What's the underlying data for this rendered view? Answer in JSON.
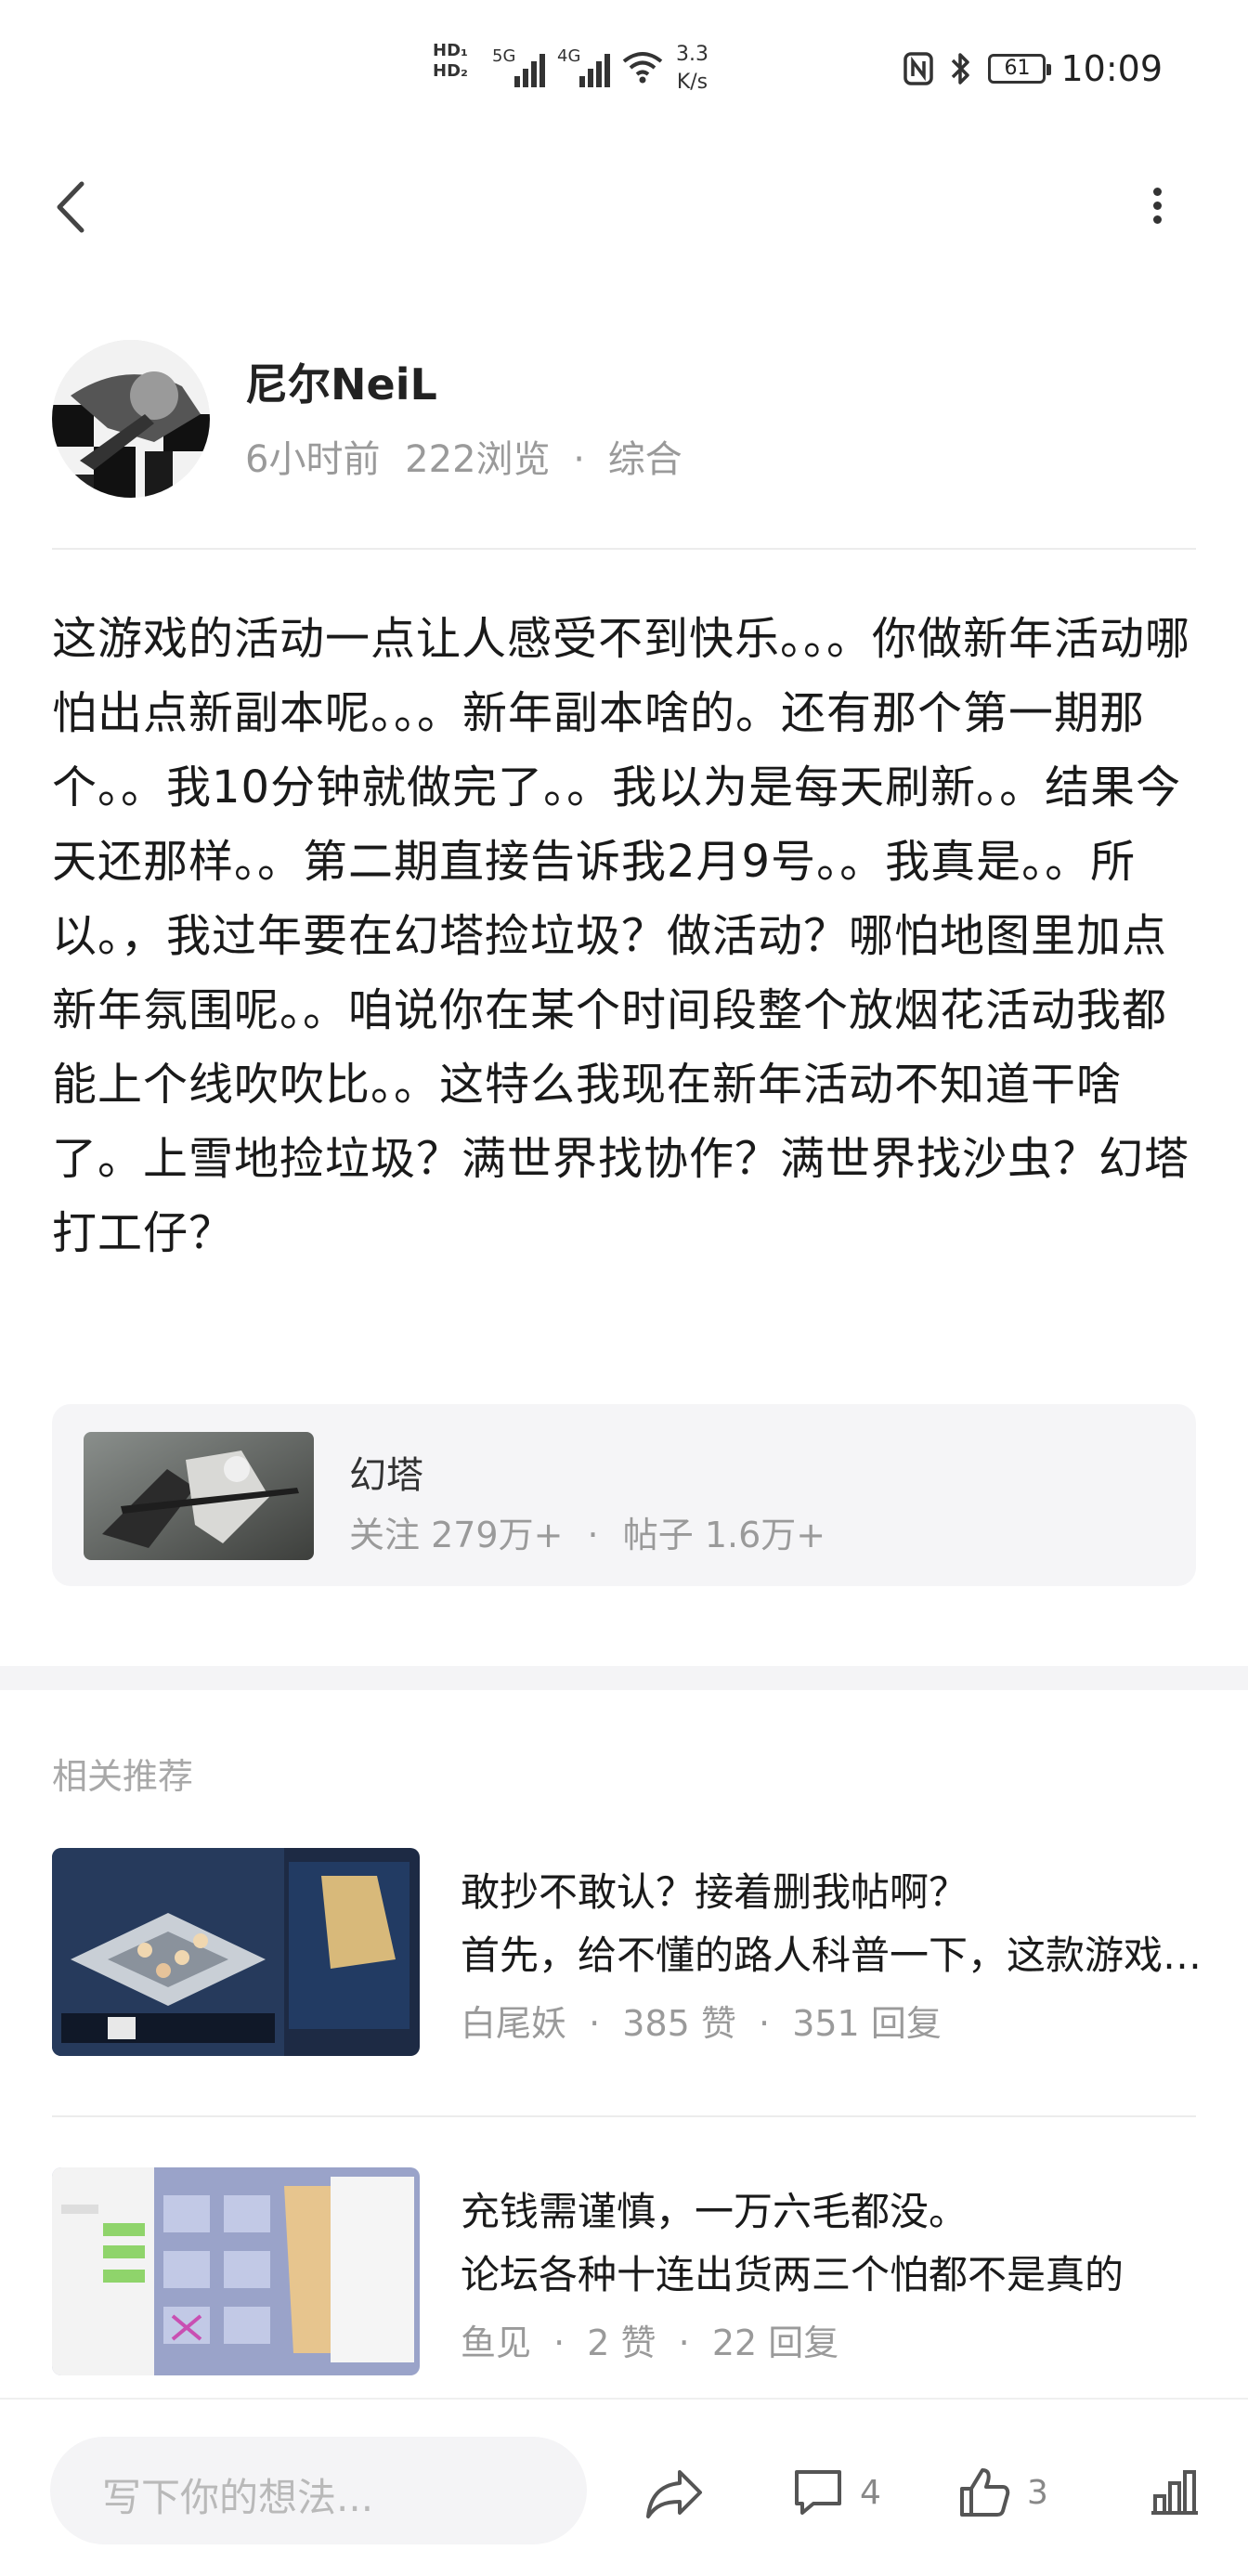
{
  "status_bar": {
    "hd1": "HD₁",
    "hd2": "HD₂",
    "net1": "5G",
    "net2": "4G",
    "speed_value": "3.3",
    "speed_unit": "K/s",
    "nfc_icon": "nfc-icon",
    "bluetooth_icon": "bluetooth-icon",
    "battery": "61",
    "time": "10:09"
  },
  "header": {
    "back_icon": "chevron-left-icon",
    "more_icon": "more-vertical-icon"
  },
  "author": {
    "name": "尼尔NeiL",
    "time": "6小时前",
    "views": "222浏览",
    "category": "综合"
  },
  "post": {
    "body": "这游戏的活动一点让人感受不到快乐。。。你做新年活动哪怕出点新副本呢。。。新年副本啥的。还有那个第一期那个。。我10分钟就做完了。。我以为是每天刷新。。结果今天还那样。。第二期直接告诉我2月9号。。我真是。。所以。，我过年要在幻塔捡垃圾？做活动？哪怕地图里加点新年氛围呢。。咱说你在某个时间段整个放烟花活动我都能上个线吹吹比。。这特么我现在新年活动不知道干啥了。上雪地捡垃圾？满世界找协作？满世界找沙虫？幻塔打工仔？"
  },
  "community": {
    "name": "幻塔",
    "followers": "关注 279万+",
    "posts": "帖子 1.6万+"
  },
  "related": {
    "section_title": "相关推荐",
    "items": [
      {
        "title": "敢抄不敢认？接着删我帖啊？",
        "desc": "首先，给不懂的路人科普一下，这款游戏是幻塔的新年活动",
        "author": "白尾妖",
        "likes": "385 赞",
        "replies": "351 回复"
      },
      {
        "title": "充钱需谨慎，一万六毛都没。",
        "desc": "论坛各种十连出货两三个怕都不是真的",
        "author": "鱼见",
        "likes": "2 赞",
        "replies": "22 回复"
      }
    ]
  },
  "bottom_bar": {
    "input_placeholder": "写下你的想法...",
    "share_icon": "share-icon",
    "comment_icon": "comment-icon",
    "comment_count": "4",
    "like_icon": "thumbs-up-icon",
    "like_count": "3",
    "stats_icon": "bar-chart-icon"
  },
  "colors": {
    "muted_text": "#9a9a9a",
    "card_bg": "#f5f5f7",
    "icon": "#555555"
  }
}
